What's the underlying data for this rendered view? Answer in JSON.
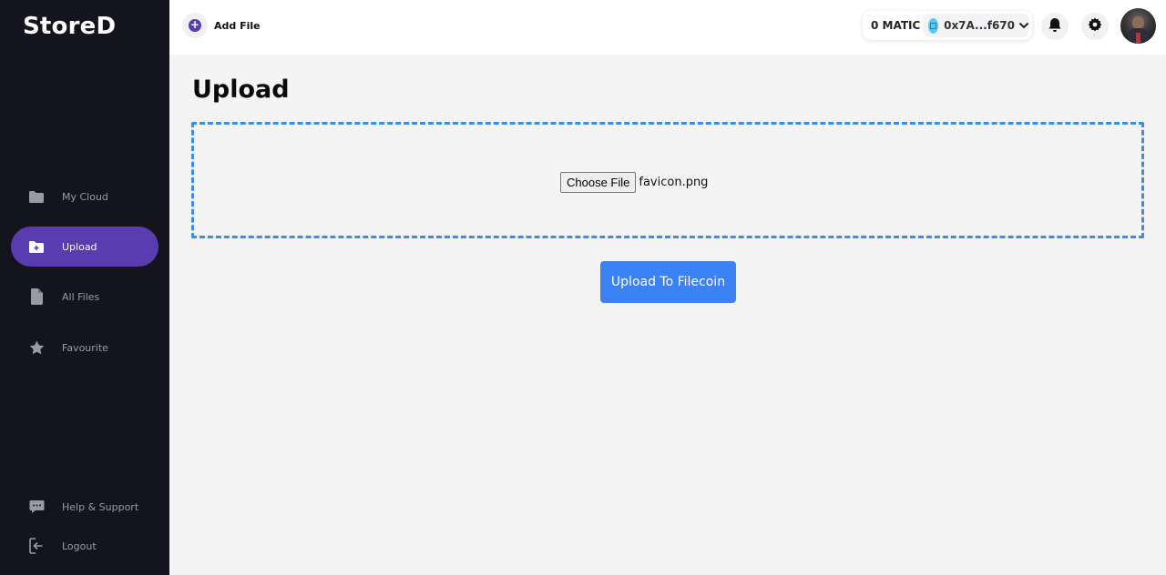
{
  "app": {
    "logo": "StoreD"
  },
  "sidebar": {
    "items": [
      {
        "label": "My Cloud",
        "icon": "folder-icon"
      },
      {
        "label": "Upload",
        "icon": "folder-plus-icon",
        "active": true
      },
      {
        "label": "All Files",
        "icon": "file-icon"
      },
      {
        "label": "Favourite",
        "icon": "star-icon"
      }
    ],
    "bottom": [
      {
        "label": "Help & Support",
        "icon": "chat-icon"
      },
      {
        "label": "Logout",
        "icon": "logout-icon"
      }
    ]
  },
  "header": {
    "add_file_label": "Add File",
    "balance": "0 MATIC",
    "account": "0x7A...f670",
    "icons": [
      "bell-icon",
      "gear-icon",
      "avatar"
    ]
  },
  "main": {
    "title": "Upload",
    "choose_file_label": "Choose File",
    "file_name": "favicon.png",
    "upload_button_label": "Upload To Filecoin"
  },
  "colors": {
    "sidebar_bg": "#14141f",
    "active_item": "#5b3cb0",
    "accent_blue": "#3b82f6",
    "dropzone_border": "#3a8ee6"
  }
}
